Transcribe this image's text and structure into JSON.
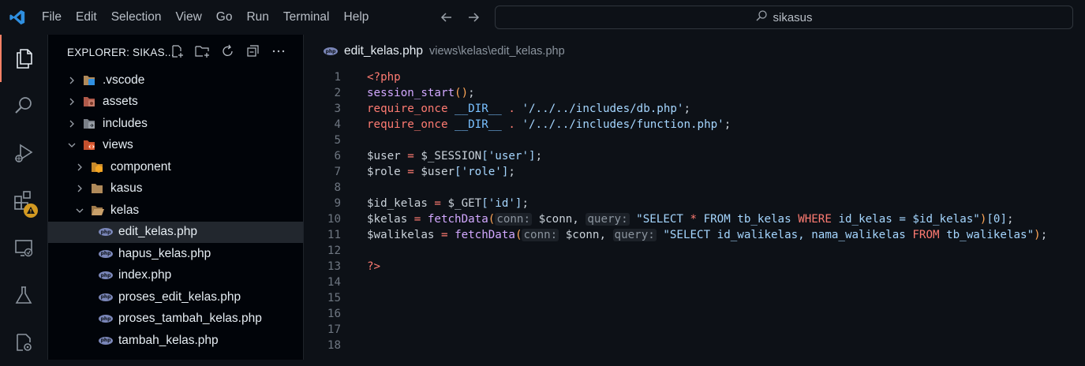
{
  "menu": [
    "File",
    "Edit",
    "Selection",
    "View",
    "Go",
    "Run",
    "Terminal",
    "Help"
  ],
  "command_center": {
    "text": "sikasus"
  },
  "sidebar": {
    "title": "EXPLORER: SIKAS...",
    "tree": [
      {
        "label": ".vscode",
        "indent": 0,
        "chevron": "right",
        "icon": "vscode-folder-icon"
      },
      {
        "label": "assets",
        "indent": 0,
        "chevron": "right",
        "icon": "assets-folder-icon"
      },
      {
        "label": "includes",
        "indent": 0,
        "chevron": "right",
        "icon": "includes-folder-icon"
      },
      {
        "label": "views",
        "indent": 0,
        "chevron": "down",
        "icon": "views-folder-icon"
      },
      {
        "label": "component",
        "indent": 1,
        "chevron": "right",
        "icon": "component-folder-icon"
      },
      {
        "label": "kasus",
        "indent": 1,
        "chevron": "right",
        "icon": "folder-icon"
      },
      {
        "label": "kelas",
        "indent": 1,
        "chevron": "down",
        "icon": "folder-open-icon"
      },
      {
        "label": "edit_kelas.php",
        "indent": 2,
        "chevron": "",
        "icon": "php-file-icon",
        "selected": true
      },
      {
        "label": "hapus_kelas.php",
        "indent": 2,
        "chevron": "",
        "icon": "php-file-icon"
      },
      {
        "label": "index.php",
        "indent": 2,
        "chevron": "",
        "icon": "php-file-icon"
      },
      {
        "label": "proses_edit_kelas.php",
        "indent": 2,
        "chevron": "",
        "icon": "php-file-icon"
      },
      {
        "label": "proses_tambah_kelas.php",
        "indent": 2,
        "chevron": "",
        "icon": "php-file-icon"
      },
      {
        "label": "tambah_kelas.php",
        "indent": 2,
        "chevron": "",
        "icon": "php-file-icon"
      }
    ]
  },
  "editor": {
    "file_name": "edit_kelas.php",
    "file_path": "views\\kelas\\edit_kelas.php",
    "lines": [
      {
        "n": "1",
        "tokens": [
          [
            "k",
            "<?php"
          ]
        ]
      },
      {
        "n": "2",
        "tokens": [
          [
            "f",
            "session_start"
          ],
          [
            "v",
            "()"
          ],
          [
            "p",
            ";"
          ]
        ]
      },
      {
        "n": "3",
        "tokens": [
          [
            "k",
            "require_once "
          ],
          [
            "c",
            "__DIR__"
          ],
          [
            "k",
            " . "
          ],
          [
            "s",
            "'/../../includes/db.php'"
          ],
          [
            "p",
            ";"
          ]
        ]
      },
      {
        "n": "4",
        "tokens": [
          [
            "k",
            "require_once "
          ],
          [
            "c",
            "__DIR__"
          ],
          [
            "k",
            " . "
          ],
          [
            "s",
            "'/../../includes/function.php'"
          ],
          [
            "p",
            ";"
          ]
        ]
      },
      {
        "n": "5",
        "tokens": []
      },
      {
        "n": "6",
        "tokens": [
          [
            "p",
            "$user "
          ],
          [
            "k",
            "="
          ],
          [
            "p",
            " $_SESSION"
          ],
          [
            "s",
            "['user']"
          ],
          [
            "p",
            ";"
          ]
        ]
      },
      {
        "n": "7",
        "tokens": [
          [
            "p",
            "$role "
          ],
          [
            "k",
            "="
          ],
          [
            "p",
            " $user"
          ],
          [
            "s",
            "['role']"
          ],
          [
            "p",
            ";"
          ]
        ]
      },
      {
        "n": "8",
        "tokens": []
      },
      {
        "n": "9",
        "tokens": [
          [
            "p",
            "$id_kelas "
          ],
          [
            "k",
            "="
          ],
          [
            "p",
            " $_GET"
          ],
          [
            "s",
            "['id']"
          ],
          [
            "p",
            ";"
          ]
        ]
      },
      {
        "n": "10",
        "tokens": [
          [
            "p",
            "$kelas "
          ],
          [
            "k",
            "="
          ],
          [
            "p",
            " "
          ],
          [
            "f",
            "fetchData"
          ],
          [
            "v",
            "("
          ],
          [
            "hint",
            "conn:"
          ],
          [
            "p",
            " $conn, "
          ],
          [
            "hint",
            "query:"
          ],
          [
            "p",
            " "
          ],
          [
            "s",
            "\"SELECT "
          ],
          [
            "k",
            "*"
          ],
          [
            "s",
            " FROM tb_kelas "
          ],
          [
            "k",
            "WHERE"
          ],
          [
            "s",
            " id_kelas = $id_kelas\""
          ],
          [
            "v",
            ")"
          ],
          [
            "s",
            "[0]"
          ],
          [
            "p",
            ";"
          ]
        ]
      },
      {
        "n": "11",
        "tokens": [
          [
            "p",
            "$walikelas "
          ],
          [
            "k",
            "="
          ],
          [
            "p",
            " "
          ],
          [
            "f",
            "fetchData"
          ],
          [
            "v",
            "("
          ],
          [
            "hint",
            "conn:"
          ],
          [
            "p",
            " $conn, "
          ],
          [
            "hint",
            "query:"
          ],
          [
            "p",
            " "
          ],
          [
            "s",
            "\"SELECT id_walikelas, nama_walikelas "
          ],
          [
            "k",
            "FROM"
          ],
          [
            "s",
            " tb_walikelas\""
          ],
          [
            "v",
            ")"
          ],
          [
            "p",
            ";"
          ]
        ]
      },
      {
        "n": "12",
        "tokens": []
      },
      {
        "n": "13",
        "tokens": [
          [
            "k",
            "?>"
          ]
        ]
      },
      {
        "n": "14",
        "tokens": []
      },
      {
        "n": "15",
        "tokens": []
      },
      {
        "n": "16",
        "tokens": []
      },
      {
        "n": "17",
        "tokens": []
      },
      {
        "n": "18",
        "tokens": []
      }
    ]
  },
  "colors": {
    "accent": "#f78166",
    "background": "#0d1117",
    "sidebar": "#010409",
    "warning_badge": "#d29922"
  }
}
